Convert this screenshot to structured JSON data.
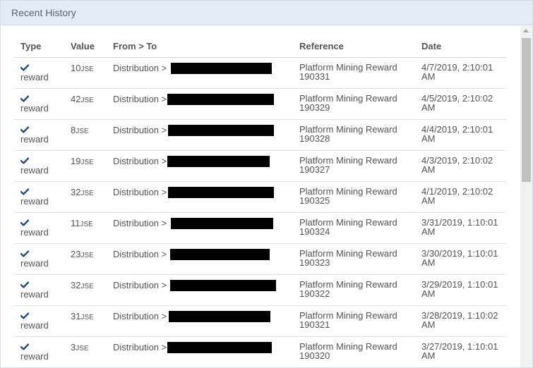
{
  "panel": {
    "title": "Recent History"
  },
  "table": {
    "columns": {
      "type": "Type",
      "value": "Value",
      "from_to": "From > To",
      "reference": "Reference",
      "date": "Date"
    },
    "rows": [
      {
        "type": "reward",
        "value": "10",
        "unit": "JSE",
        "from": "Distribution >",
        "reference": "Platform Mining Reward 190331",
        "date": "4/7/2019, 2:10:01 AM"
      },
      {
        "type": "reward",
        "value": "42",
        "unit": "JSE",
        "from": "Distribution >",
        "reference": "Platform Mining Reward 190329",
        "date": "4/5/2019, 2:10:02 AM"
      },
      {
        "type": "reward",
        "value": "8",
        "unit": "JSE",
        "from": "Distribution >",
        "reference": "Platform Mining Reward 190328",
        "date": "4/4/2019, 2:10:01 AM"
      },
      {
        "type": "reward",
        "value": "19",
        "unit": "JSE",
        "from": "Distribution >",
        "reference": "Platform Mining Reward 190327",
        "date": "4/3/2019, 2:10:02 AM"
      },
      {
        "type": "reward",
        "value": "32",
        "unit": "JSE",
        "from": "Distribution >",
        "reference": "Platform Mining Reward 190325",
        "date": "4/1/2019, 2:10:02 AM"
      },
      {
        "type": "reward",
        "value": "11",
        "unit": "JSE",
        "from": "Distribution >",
        "reference": "Platform Mining Reward 190324",
        "date": "3/31/2019, 1:10:01 AM"
      },
      {
        "type": "reward",
        "value": "23",
        "unit": "JSE",
        "from": "Distribution >",
        "reference": "Platform Mining Reward 190323",
        "date": "3/30/2019, 1:10:01 AM"
      },
      {
        "type": "reward",
        "value": "32",
        "unit": "JSE",
        "from": "Distribution >",
        "reference": "Platform Mining Reward 190322",
        "date": "3/29/2019, 1:10:01 AM"
      },
      {
        "type": "reward",
        "value": "31",
        "unit": "JSE",
        "from": "Distribution >",
        "reference": "Platform Mining Reward 190321",
        "date": "3/28/2019, 1:10:02 AM"
      },
      {
        "type": "reward",
        "value": "3",
        "unit": "JSE",
        "from": "Distribution >",
        "reference": "Platform Mining Reward 190320",
        "date": "3/27/2019, 1:10:01 AM"
      }
    ]
  },
  "colors": {
    "header_bg": "#e3ebf7",
    "check": "#1f4e79",
    "text": "#555555"
  },
  "icons": {
    "type_icon": "checkmark-icon"
  }
}
